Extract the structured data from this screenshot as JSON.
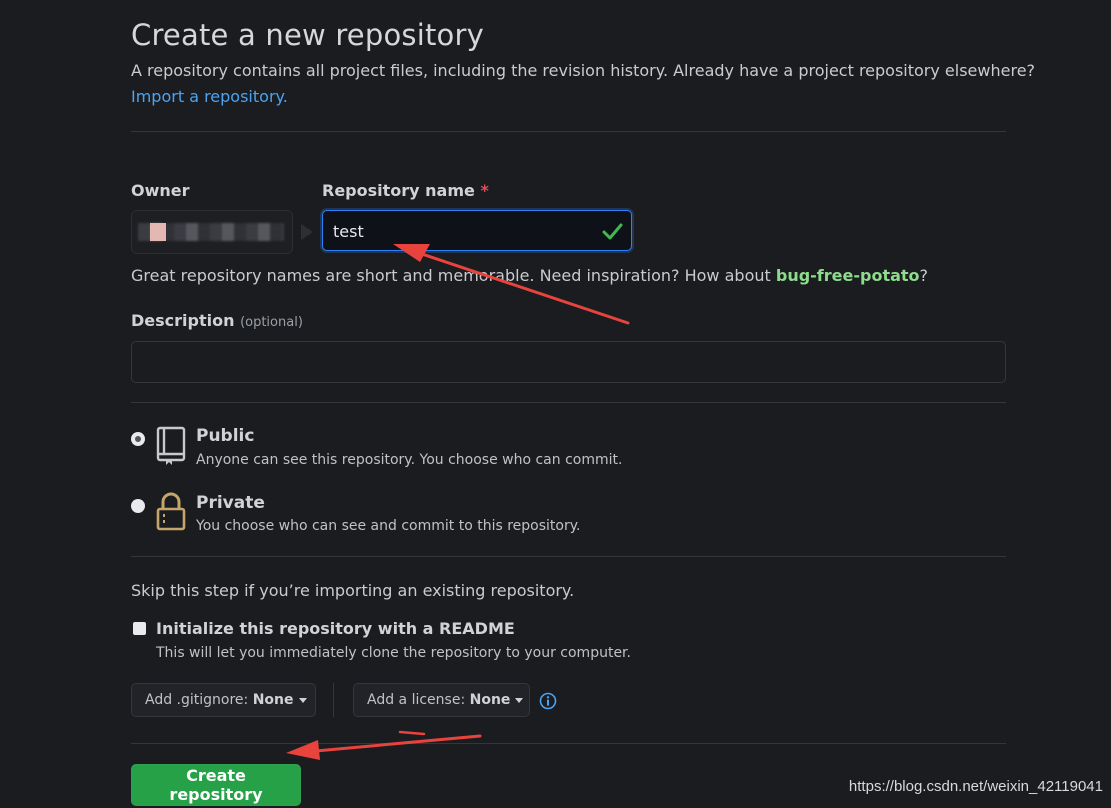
{
  "header": {
    "title": "Create a new repository",
    "subtitle": "A repository contains all project files, including the revision history. Already have a project repository elsewhere?",
    "import_link": "Import a repository."
  },
  "form": {
    "owner_label": "Owner",
    "repo_name_label": "Repository name",
    "required_mark": "*",
    "repo_name_value": "test",
    "hint_prefix": "Great repository names are short and memorable. Need inspiration? How about ",
    "hint_suggestion": "bug-free-potato",
    "hint_suffix": "?",
    "description_label": "Description",
    "description_optional": "(optional)",
    "description_value": ""
  },
  "visibility": {
    "public": {
      "title": "Public",
      "desc": "Anyone can see this repository. You choose who can commit.",
      "selected": true,
      "icon": "repo-book-icon"
    },
    "private": {
      "title": "Private",
      "desc": "You choose who can see and commit to this repository.",
      "selected": false,
      "icon": "lock-icon"
    }
  },
  "init": {
    "skip_text": "Skip this step if you’re importing an existing repository.",
    "readme_title": "Initialize this repository with a README",
    "readme_desc": "This will let you immediately clone the repository to your computer.",
    "readme_checked": false
  },
  "dropdowns": {
    "gitignore_label": "Add .gitignore:",
    "gitignore_value": "None",
    "license_label": "Add a license:",
    "license_value": "None"
  },
  "submit": {
    "label": "Create repository"
  },
  "watermark": "https://blog.csdn.net/weixin_42119041",
  "colors": {
    "background": "#1b1c1f",
    "link": "#4aa3f3",
    "suggestion": "#8ddb8c",
    "primary_button": "#26a148",
    "annotation_arrow": "#e8433c",
    "valid_check": "#3fb950"
  }
}
